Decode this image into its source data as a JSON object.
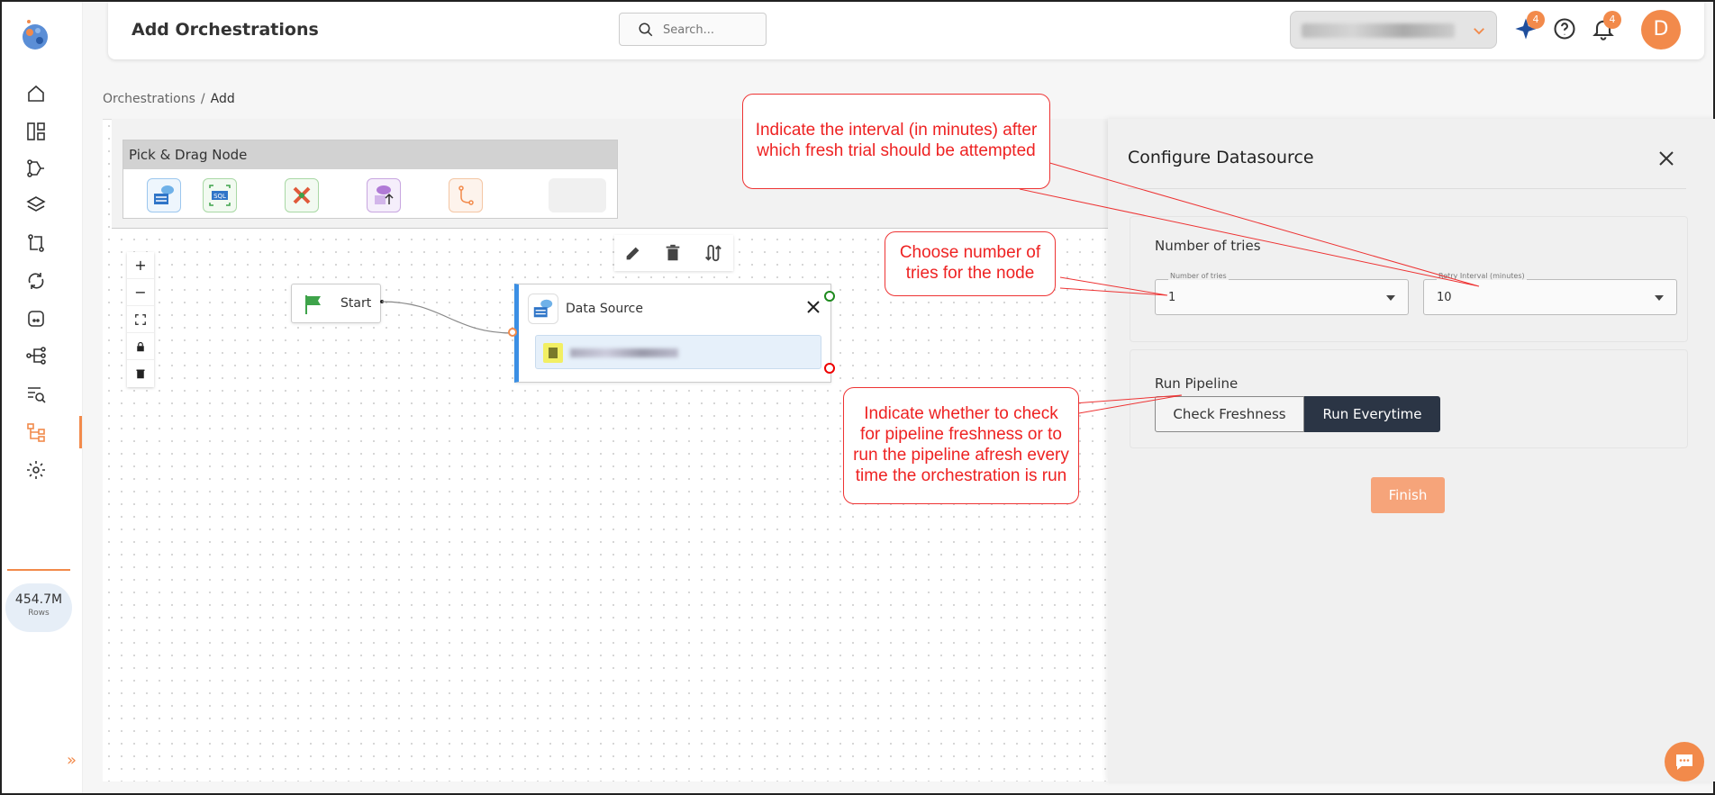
{
  "header": {
    "page_title": "Add Orchestrations",
    "search_placeholder": "Search...",
    "ai_badge": "4",
    "notifications_badge": "4",
    "avatar_initial": "D"
  },
  "breadcrumb": {
    "root": "Orchestrations",
    "separator": "/",
    "current": "Add"
  },
  "sidebar": {
    "items": [
      {
        "name": "home-icon"
      },
      {
        "name": "dashboard-icon"
      },
      {
        "name": "pipeline-icon"
      },
      {
        "name": "layers-icon"
      },
      {
        "name": "transform-icon"
      },
      {
        "name": "sync-icon"
      },
      {
        "name": "storage-icon"
      },
      {
        "name": "flow-icon"
      },
      {
        "name": "query-icon"
      },
      {
        "name": "orchestration-icon",
        "active": true
      },
      {
        "name": "gear-icon"
      }
    ],
    "rows_value": "454.7M",
    "rows_label": "Rows"
  },
  "palette": {
    "title": "Pick & Drag Node",
    "nodes": [
      "datasource-node-icon",
      "sql-node-icon",
      "transform-node-icon",
      "upload-node-icon",
      "branch-node-icon"
    ]
  },
  "canvas": {
    "start_label": "Start",
    "datasource_label": "Data Source"
  },
  "panel": {
    "title": "Configure Datasource",
    "tries_section_title": "Number of tries",
    "tries_field_label": "Number of tries",
    "tries_value": "1",
    "retry_field_label": "Retry Interval (minutes)",
    "retry_value": "10",
    "run_section_title": "Run Pipeline",
    "check_freshness_label": "Check Freshness",
    "run_everytime_label": "Run Everytime",
    "finish_label": "Finish"
  },
  "annotations": {
    "interval": "Indicate the interval (in minutes) after which fresh trial should be attempted",
    "tries": "Choose number of tries for the node",
    "pipeline": "Indicate whether to check for pipeline freshness or to run the pipeline afresh every time the orchestration is run"
  },
  "colors": {
    "accent": "#f28a4b",
    "annotation": "#e22222",
    "node_border": "#3b8fe4",
    "dark_button": "#2b3545"
  }
}
